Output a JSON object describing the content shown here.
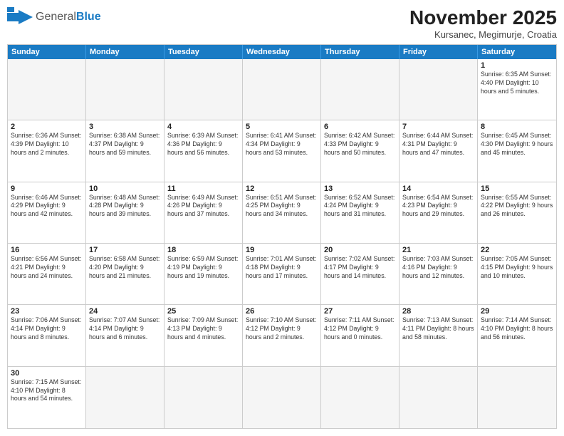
{
  "logo": {
    "text_general": "General",
    "text_blue": "Blue"
  },
  "title": "November 2025",
  "subtitle": "Kursanec, Megimurje, Croatia",
  "header_days": [
    "Sunday",
    "Monday",
    "Tuesday",
    "Wednesday",
    "Thursday",
    "Friday",
    "Saturday"
  ],
  "weeks": [
    [
      {
        "day": "",
        "info": ""
      },
      {
        "day": "",
        "info": ""
      },
      {
        "day": "",
        "info": ""
      },
      {
        "day": "",
        "info": ""
      },
      {
        "day": "",
        "info": ""
      },
      {
        "day": "",
        "info": ""
      },
      {
        "day": "1",
        "info": "Sunrise: 6:35 AM\nSunset: 4:40 PM\nDaylight: 10 hours and 5 minutes."
      }
    ],
    [
      {
        "day": "2",
        "info": "Sunrise: 6:36 AM\nSunset: 4:39 PM\nDaylight: 10 hours and 2 minutes."
      },
      {
        "day": "3",
        "info": "Sunrise: 6:38 AM\nSunset: 4:37 PM\nDaylight: 9 hours and 59 minutes."
      },
      {
        "day": "4",
        "info": "Sunrise: 6:39 AM\nSunset: 4:36 PM\nDaylight: 9 hours and 56 minutes."
      },
      {
        "day": "5",
        "info": "Sunrise: 6:41 AM\nSunset: 4:34 PM\nDaylight: 9 hours and 53 minutes."
      },
      {
        "day": "6",
        "info": "Sunrise: 6:42 AM\nSunset: 4:33 PM\nDaylight: 9 hours and 50 minutes."
      },
      {
        "day": "7",
        "info": "Sunrise: 6:44 AM\nSunset: 4:31 PM\nDaylight: 9 hours and 47 minutes."
      },
      {
        "day": "8",
        "info": "Sunrise: 6:45 AM\nSunset: 4:30 PM\nDaylight: 9 hours and 45 minutes."
      }
    ],
    [
      {
        "day": "9",
        "info": "Sunrise: 6:46 AM\nSunset: 4:29 PM\nDaylight: 9 hours and 42 minutes."
      },
      {
        "day": "10",
        "info": "Sunrise: 6:48 AM\nSunset: 4:28 PM\nDaylight: 9 hours and 39 minutes."
      },
      {
        "day": "11",
        "info": "Sunrise: 6:49 AM\nSunset: 4:26 PM\nDaylight: 9 hours and 37 minutes."
      },
      {
        "day": "12",
        "info": "Sunrise: 6:51 AM\nSunset: 4:25 PM\nDaylight: 9 hours and 34 minutes."
      },
      {
        "day": "13",
        "info": "Sunrise: 6:52 AM\nSunset: 4:24 PM\nDaylight: 9 hours and 31 minutes."
      },
      {
        "day": "14",
        "info": "Sunrise: 6:54 AM\nSunset: 4:23 PM\nDaylight: 9 hours and 29 minutes."
      },
      {
        "day": "15",
        "info": "Sunrise: 6:55 AM\nSunset: 4:22 PM\nDaylight: 9 hours and 26 minutes."
      }
    ],
    [
      {
        "day": "16",
        "info": "Sunrise: 6:56 AM\nSunset: 4:21 PM\nDaylight: 9 hours and 24 minutes."
      },
      {
        "day": "17",
        "info": "Sunrise: 6:58 AM\nSunset: 4:20 PM\nDaylight: 9 hours and 21 minutes."
      },
      {
        "day": "18",
        "info": "Sunrise: 6:59 AM\nSunset: 4:19 PM\nDaylight: 9 hours and 19 minutes."
      },
      {
        "day": "19",
        "info": "Sunrise: 7:01 AM\nSunset: 4:18 PM\nDaylight: 9 hours and 17 minutes."
      },
      {
        "day": "20",
        "info": "Sunrise: 7:02 AM\nSunset: 4:17 PM\nDaylight: 9 hours and 14 minutes."
      },
      {
        "day": "21",
        "info": "Sunrise: 7:03 AM\nSunset: 4:16 PM\nDaylight: 9 hours and 12 minutes."
      },
      {
        "day": "22",
        "info": "Sunrise: 7:05 AM\nSunset: 4:15 PM\nDaylight: 9 hours and 10 minutes."
      }
    ],
    [
      {
        "day": "23",
        "info": "Sunrise: 7:06 AM\nSunset: 4:14 PM\nDaylight: 9 hours and 8 minutes."
      },
      {
        "day": "24",
        "info": "Sunrise: 7:07 AM\nSunset: 4:14 PM\nDaylight: 9 hours and 6 minutes."
      },
      {
        "day": "25",
        "info": "Sunrise: 7:09 AM\nSunset: 4:13 PM\nDaylight: 9 hours and 4 minutes."
      },
      {
        "day": "26",
        "info": "Sunrise: 7:10 AM\nSunset: 4:12 PM\nDaylight: 9 hours and 2 minutes."
      },
      {
        "day": "27",
        "info": "Sunrise: 7:11 AM\nSunset: 4:12 PM\nDaylight: 9 hours and 0 minutes."
      },
      {
        "day": "28",
        "info": "Sunrise: 7:13 AM\nSunset: 4:11 PM\nDaylight: 8 hours and 58 minutes."
      },
      {
        "day": "29",
        "info": "Sunrise: 7:14 AM\nSunset: 4:10 PM\nDaylight: 8 hours and 56 minutes."
      }
    ],
    [
      {
        "day": "30",
        "info": "Sunrise: 7:15 AM\nSunset: 4:10 PM\nDaylight: 8 hours and 54 minutes."
      },
      {
        "day": "",
        "info": ""
      },
      {
        "day": "",
        "info": ""
      },
      {
        "day": "",
        "info": ""
      },
      {
        "day": "",
        "info": ""
      },
      {
        "day": "",
        "info": ""
      },
      {
        "day": "",
        "info": ""
      }
    ]
  ]
}
